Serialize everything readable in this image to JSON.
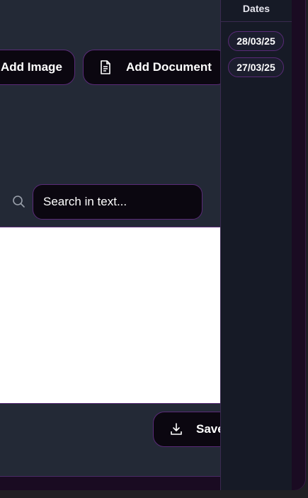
{
  "toolbar": {
    "add_image_label": "Add Image",
    "add_document_label": "Add Document"
  },
  "search": {
    "placeholder": "Search in text..."
  },
  "actions": {
    "save_label": "Save"
  },
  "sidebar": {
    "header": "Dates",
    "dates": [
      "28/03/25",
      "27/03/25"
    ]
  },
  "icons": {
    "document": "document-icon",
    "search": "search-icon",
    "download": "download-icon"
  }
}
